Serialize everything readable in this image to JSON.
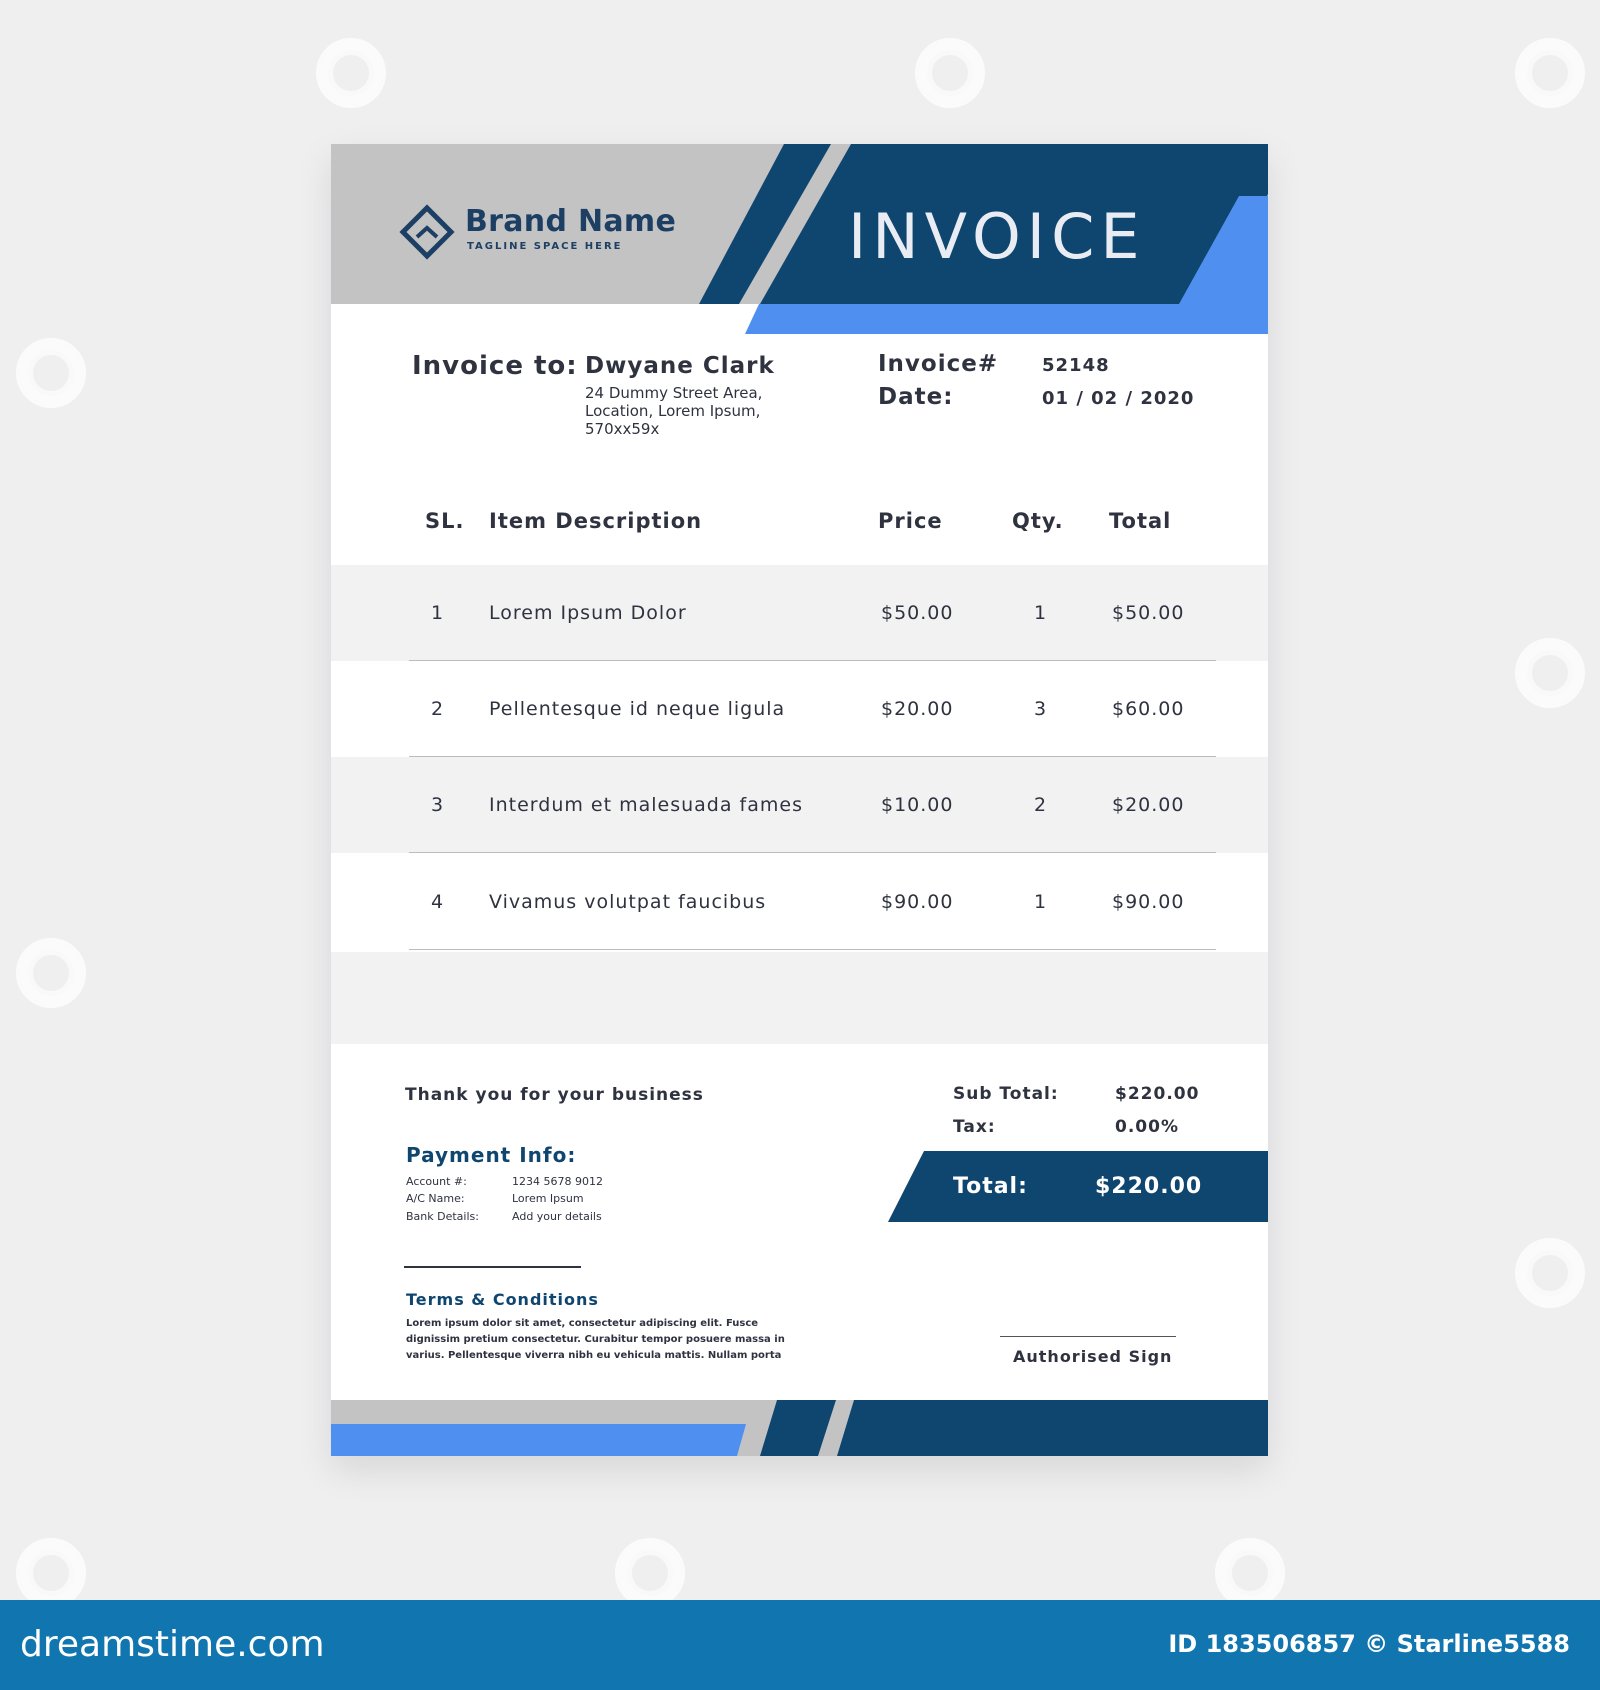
{
  "brand": {
    "name": "Brand Name",
    "tagline": "TAGLINE SPACE HERE"
  },
  "title": "INVOICE",
  "bill_to": {
    "label": "Invoice to:",
    "name": "Dwyane Clark",
    "address": [
      "24 Dummy Street Area,",
      "Location, Lorem Ipsum,",
      "570xx59x"
    ]
  },
  "meta": {
    "invoice_label": "Invoice#",
    "invoice_number": "52148",
    "date_label": "Date:",
    "date": "01 / 02 / 2020"
  },
  "table": {
    "headers": {
      "sl": "SL.",
      "description": "Item Description",
      "price": "Price",
      "qty": "Qty.",
      "total": "Total"
    },
    "rows": [
      {
        "sl": "1",
        "description": "Lorem Ipsum Dolor",
        "price": "$50.00",
        "qty": "1",
        "total": "$50.00"
      },
      {
        "sl": "2",
        "description": "Pellentesque id neque ligula",
        "price": "$20.00",
        "qty": "3",
        "total": "$60.00"
      },
      {
        "sl": "3",
        "description": "Interdum et malesuada fames",
        "price": "$10.00",
        "qty": "2",
        "total": "$20.00"
      },
      {
        "sl": "4",
        "description": "Vivamus volutpat faucibus",
        "price": "$90.00",
        "qty": "1",
        "total": "$90.00"
      }
    ]
  },
  "thanks": "Thank you for your business",
  "payment": {
    "title": "Payment Info:",
    "account_label": "Account #:",
    "account_value": "1234 5678 9012",
    "name_label": "A/C Name:",
    "name_value": "Lorem Ipsum",
    "bank_label": "Bank Details:",
    "bank_value": "Add your details"
  },
  "summary": {
    "subtotal_label": "Sub Total:",
    "subtotal_value": "$220.00",
    "tax_label": "Tax:",
    "tax_value": "0.00%",
    "total_label": "Total:",
    "total_value": "$220.00"
  },
  "terms": {
    "title": "Terms & Conditions",
    "lines": [
      "Lorem ipsum dolor sit amet, consectetur adipiscing elit. Fusce",
      "dignissim pretium consectetur. Curabitur tempor posuere massa in",
      "varius. Pellentesque viverra nibh eu vehicula mattis. Nullam porta"
    ]
  },
  "signature": "Authorised Sign",
  "stock": {
    "site": "dreamstime.com",
    "id_text": "ID 183506857 © Starline5588"
  },
  "colors": {
    "navy": "#0f4670",
    "blue": "#4f8ff0",
    "grey": "#c3c3c3",
    "page_bg": "#efeff0",
    "bar": "#1176b0"
  },
  "icons": [
    "brand-diamond-icon",
    "watermark-spiral-icon"
  ]
}
